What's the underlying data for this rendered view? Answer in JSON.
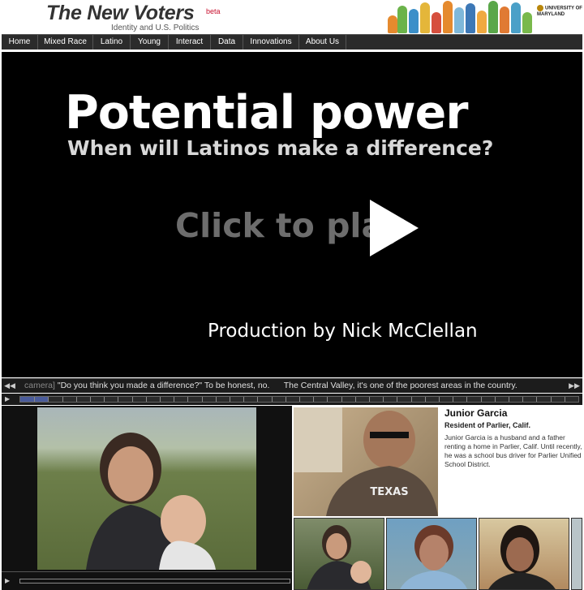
{
  "header": {
    "site_title": "The New Voters",
    "beta_label": "beta",
    "subtitle": "Identity and U.S. Politics",
    "university": "UNIVERSITY OF MARYLAND"
  },
  "nav": {
    "items": [
      "Home",
      "Mixed Race",
      "Latino",
      "Young",
      "Interact",
      "Data",
      "Innovations",
      "About Us"
    ]
  },
  "video": {
    "title": "Potential power",
    "subtitle": "When will Latinos make a difference?",
    "play_text": "Click to play",
    "credit": "Production by Nick McClellan"
  },
  "transcript": {
    "prev_icon": "rewind-icon",
    "next_icon": "fast-forward-icon",
    "faded_prefix": "camera]",
    "text_1": "\"Do you think you made a difference?\" To be honest, no.",
    "text_2": "The Central Valley, it's one of the poorest areas in the country."
  },
  "timeline": {
    "progress": 0.05
  },
  "profile": {
    "name": "Junior Garcia",
    "role": "Resident of Parlier, Calif.",
    "bio": "Junior Garcia is a husband and a father renting a home in Parlier, Calif. Until recently, he was a school bus driver for Parlier Unified School District.",
    "shirt_text": "TEXAS"
  },
  "colors": {
    "nav_bg": "#2b2b2b",
    "video_bg": "#000000",
    "progress": "#4a5b9a"
  }
}
